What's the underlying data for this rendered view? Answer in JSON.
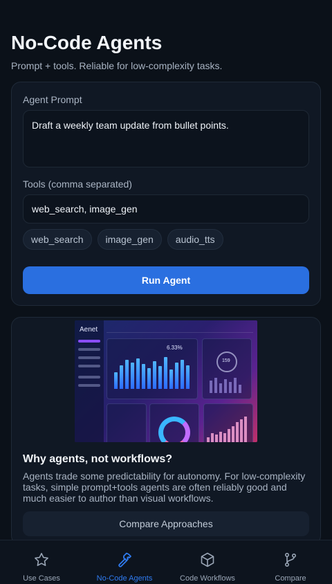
{
  "header": {
    "title": "No-Code Agents",
    "subtitle": "Prompt + tools. Reliable for low-complexity tasks."
  },
  "form": {
    "prompt_label": "Agent Prompt",
    "prompt_value": "Draft a weekly team update from bullet points.",
    "tools_label": "Tools (comma separated)",
    "tools_value": "web_search, image_gen",
    "tool_chips": [
      "web_search",
      "image_gen",
      "audio_tts"
    ],
    "run_label": "Run Agent"
  },
  "info": {
    "hero": {
      "logo": "Aenet",
      "kpi_value": "6.33%",
      "gauge_value": "159"
    },
    "title": "Why agents, not workflows?",
    "body": "Agents trade some predictability for autonomy. For low-complexity tasks, simple prompt+tools agents are often reliably good and much easier to author than visual workflows.",
    "compare_label": "Compare Approaches"
  },
  "tabbar": {
    "items": [
      {
        "label": "Use Cases",
        "icon": "star-icon",
        "active": false
      },
      {
        "label": "No-Code Agents",
        "icon": "hammer-icon",
        "active": true
      },
      {
        "label": "Code Workflows",
        "icon": "cube-icon",
        "active": false
      },
      {
        "label": "Compare",
        "icon": "git-branch-icon",
        "active": false
      }
    ]
  },
  "colors": {
    "accent": "#2a6fe0",
    "active_tab": "#2f7bf0",
    "background": "#0b1119",
    "card": "#101824"
  }
}
